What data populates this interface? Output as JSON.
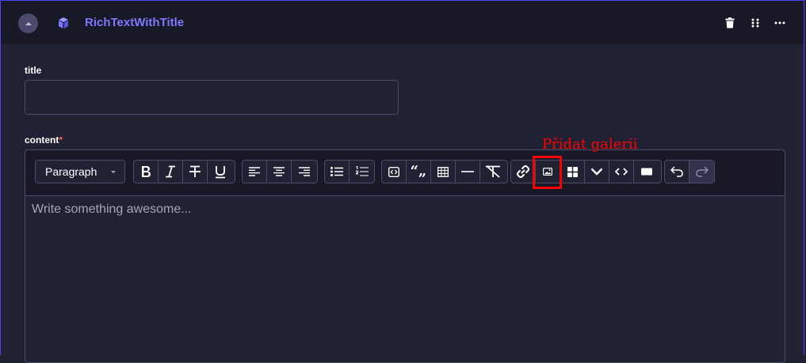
{
  "component": {
    "title": "RichTextWithTitle",
    "icons": [
      "collapse-icon",
      "cube-icon",
      "trash-icon",
      "drag-icon",
      "more-icon"
    ]
  },
  "fields": {
    "title_label": "title",
    "title_value": "",
    "content_label": "content",
    "content_required_mark": "*"
  },
  "editor": {
    "format_select": "Paragraph",
    "placeholder": "Write something awesome...",
    "toolbar_icons": [
      "bold-icon",
      "italic-icon",
      "strikethrough-icon",
      "underline-icon",
      "align-left-icon",
      "align-center-icon",
      "align-right-icon",
      "bullet-list-icon",
      "ordered-list-icon",
      "code-block-icon",
      "blockquote-icon",
      "table-icon",
      "horizontal-rule-icon",
      "clear-format-icon",
      "link-icon",
      "gallery-icon",
      "grid-icon",
      "chevron-down-icon",
      "code-icon",
      "rectangle-icon",
      "undo-icon",
      "redo-icon"
    ]
  },
  "annotation": {
    "text": "Přidat galerii",
    "color": "#ff0000"
  },
  "colors": {
    "accent": "#7b79ff",
    "background": "#212134",
    "header_background": "#181826",
    "border": "#4a4a6a"
  }
}
